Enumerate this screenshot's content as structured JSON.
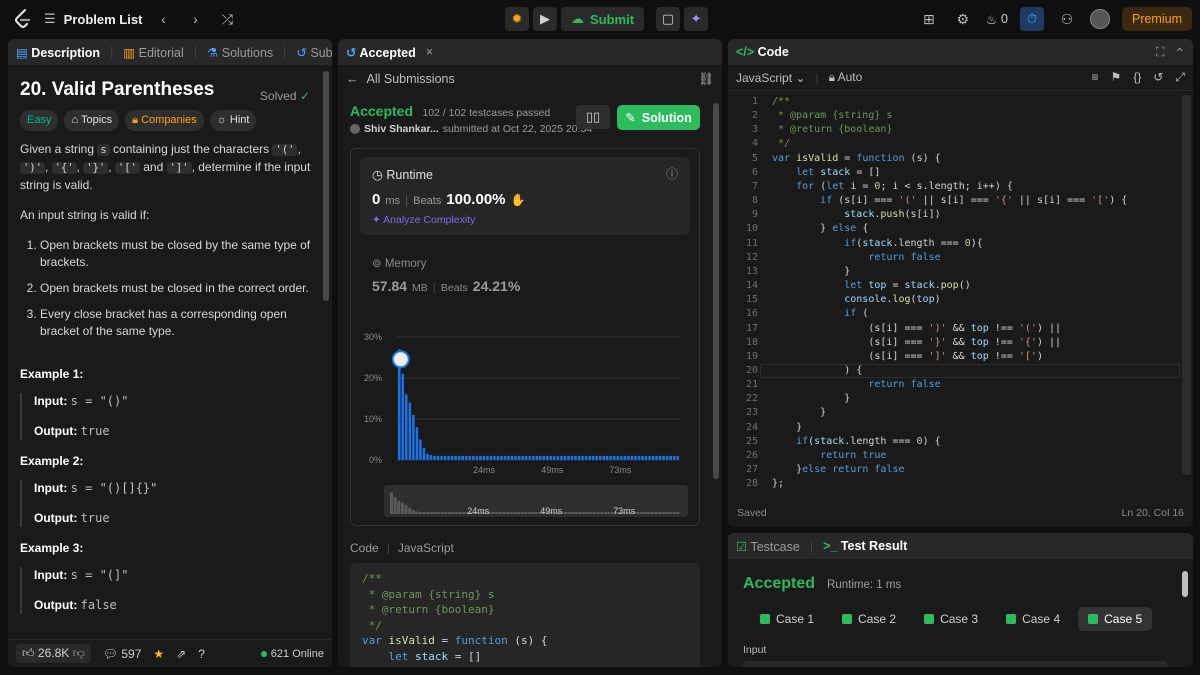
{
  "topbar": {
    "problem_list": "Problem List",
    "submit": "Submit",
    "streak": "0",
    "premium": "Premium"
  },
  "left": {
    "tabs": [
      "Description",
      "Editorial",
      "Solutions",
      "Subr"
    ],
    "title": "20. Valid Parentheses",
    "solved": "Solved",
    "tags": [
      "Easy",
      "Topics",
      "Companies",
      "Hint"
    ],
    "para1_a": "Given a string ",
    "para1_s": "s",
    "para1_b": " containing just the characters ",
    "c1": "'('",
    "c2": "')'",
    "c3": "'{'",
    "c4": "'}'",
    "c5": "'['",
    "c6": "']'",
    "para1_and": "and",
    "para1_c": ", determine if the input string is valid.",
    "para2": "An input string is valid if:",
    "rules": [
      "Open brackets must be closed by the same type of brackets.",
      "Open brackets must be closed in the correct order.",
      "Every close bracket has a corresponding open bracket of the same type."
    ],
    "examples": [
      {
        "title": "Example 1:",
        "input": "s = \"()\"",
        "output": "true"
      },
      {
        "title": "Example 2:",
        "input": "s = \"()[]{}\"",
        "output": "true"
      },
      {
        "title": "Example 3:",
        "input": "s = \"(]\"",
        "output": "false"
      }
    ],
    "input_label": "Input:",
    "output_label": "Output:",
    "likes": "26.8K",
    "comments": "597",
    "online": "621 Online"
  },
  "middle": {
    "tab": "Accepted",
    "back": "All Submissions",
    "status": "Accepted",
    "passed": "102 / 102 testcases passed",
    "user": "Shiv Shankar...",
    "submitted": "submitted at Oct 22, 2025 20:34",
    "solution_btn": "Solution",
    "runtime_label": "Runtime",
    "runtime_value": "0",
    "runtime_unit": "ms",
    "beats_label": "Beats",
    "runtime_beats": "100.00%",
    "analyze": "Analyze Complexity",
    "memory_label": "Memory",
    "memory_value": "57.84",
    "memory_unit": "MB",
    "memory_beats": "24.21%",
    "code_label": "Code",
    "code_lang": "JavaScript"
  },
  "chart_data": {
    "type": "bar",
    "yticks": [
      "30%",
      "20%",
      "10%",
      "0%"
    ],
    "ylim": [
      0,
      30
    ],
    "xticks": [
      "24ms",
      "49ms",
      "73ms"
    ],
    "values": [
      27,
      21,
      16,
      14,
      11,
      8,
      5,
      3,
      1.5,
      1.2,
      1,
      1,
      1,
      1,
      1,
      1,
      1,
      1,
      1,
      1,
      1,
      1,
      1,
      1,
      1,
      1,
      1,
      1,
      1,
      1,
      1,
      1,
      1,
      1,
      1,
      1,
      1,
      1,
      1,
      1,
      1,
      1,
      1,
      1,
      1,
      1,
      1,
      1,
      1,
      1,
      1,
      1,
      1,
      1,
      1,
      1,
      1,
      1,
      1,
      1,
      1,
      1,
      1,
      1,
      1,
      1,
      1,
      1,
      1,
      1,
      1,
      1,
      1,
      1,
      1,
      1,
      1,
      1,
      1,
      1
    ],
    "mini_xticks": [
      "24ms",
      "49ms",
      "73ms"
    ],
    "bar_color": "#1a73e8"
  },
  "code_panel": {
    "title": "Code",
    "lang": "JavaScript",
    "mode": "Auto",
    "saved": "Saved",
    "cursor": "Ln 20, Col 16"
  },
  "test_panel": {
    "tab1": "Testcase",
    "tab2": "Test Result",
    "status": "Accepted",
    "runtime": "Runtime: 1 ms",
    "cases": [
      "Case 1",
      "Case 2",
      "Case 3",
      "Case 4",
      "Case 5"
    ],
    "input_label": "Input"
  }
}
